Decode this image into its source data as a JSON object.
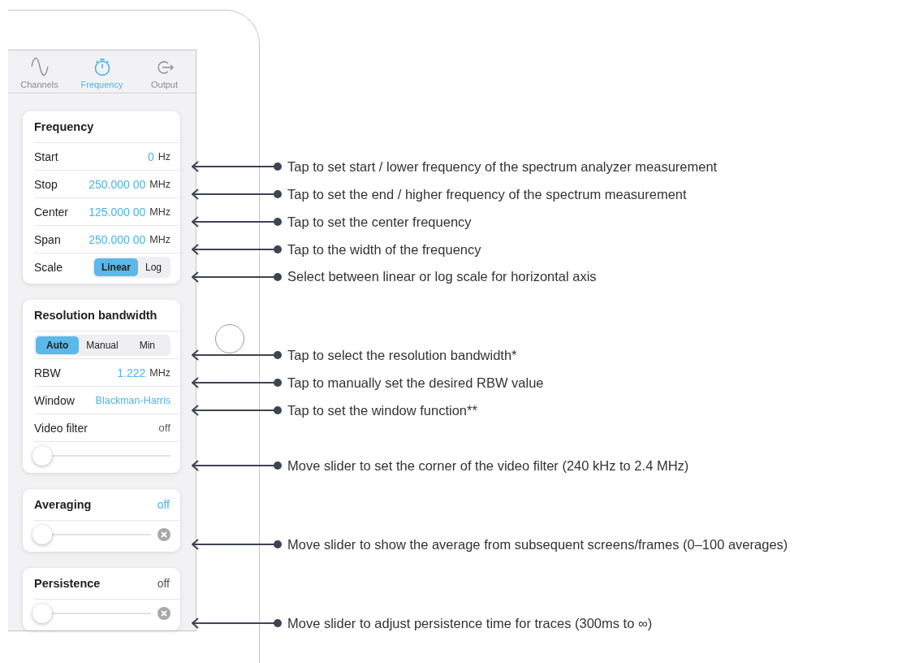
{
  "tabs": [
    {
      "label": "Channels",
      "selected": false
    },
    {
      "label": "Frequency",
      "selected": true
    },
    {
      "label": "Output",
      "selected": false
    }
  ],
  "sections": [
    {
      "title": "Frequency",
      "rows": [
        {
          "kind": "field",
          "label": "Start",
          "value": "0",
          "unit": "Hz",
          "note": "Tap to set start / lower frequency of the spectrum analyzer measurement"
        },
        {
          "kind": "field",
          "label": "Stop",
          "value": "250.000 00",
          "unit": "MHz",
          "note": "Tap to set the end / higher frequency of the spectrum measurement"
        },
        {
          "kind": "field",
          "label": "Center",
          "value": "125.000 00",
          "unit": "MHz",
          "note": "Tap to set the center frequency"
        },
        {
          "kind": "field",
          "label": "Span",
          "value": "250.000 00",
          "unit": "MHz",
          "note": "Tap to the width of the frequency"
        },
        {
          "kind": "segmented",
          "label": "Scale",
          "options": [
            {
              "label": "Linear",
              "selected": true
            },
            {
              "label": "Log",
              "selected": false
            }
          ],
          "note": "Select between linear or log scale for horizontal axis"
        }
      ]
    },
    {
      "title": "Resolution bandwidth",
      "rows": [
        {
          "kind": "segmented",
          "options": [
            {
              "label": "Auto",
              "selected": true
            },
            {
              "label": "Manual",
              "selected": false
            },
            {
              "label": "Min",
              "selected": false
            }
          ],
          "note": "Tap to select the resolution bandwidth*"
        },
        {
          "kind": "field",
          "label": "RBW",
          "value": "1.222",
          "unit": "MHz",
          "note": "Tap to manually set the desired RBW value"
        },
        {
          "kind": "field",
          "label": "Window",
          "value": "Blackman-Harris",
          "note": "Tap to set the window function**"
        },
        {
          "kind": "status",
          "label": "Video filter",
          "value": "off"
        },
        {
          "kind": "slider",
          "level": 0,
          "clear": false,
          "note": "Move slider to set the corner of the video filter (240 kHz to 2.4 MHz)"
        }
      ]
    },
    {
      "title": "Averaging",
      "value": "off",
      "active": true,
      "rows": [
        {
          "kind": "slider",
          "level": 0,
          "clear": true,
          "note": "Move slider to show the average from subsequent screens/frames (0–100 averages)"
        }
      ]
    },
    {
      "title": "Persistence",
      "value": "off",
      "active": false,
      "rows": [
        {
          "kind": "slider",
          "level": 0,
          "clear": true,
          "note": "Move slider to adjust persistence time for traces (300ms to ∞)"
        }
      ]
    }
  ]
}
